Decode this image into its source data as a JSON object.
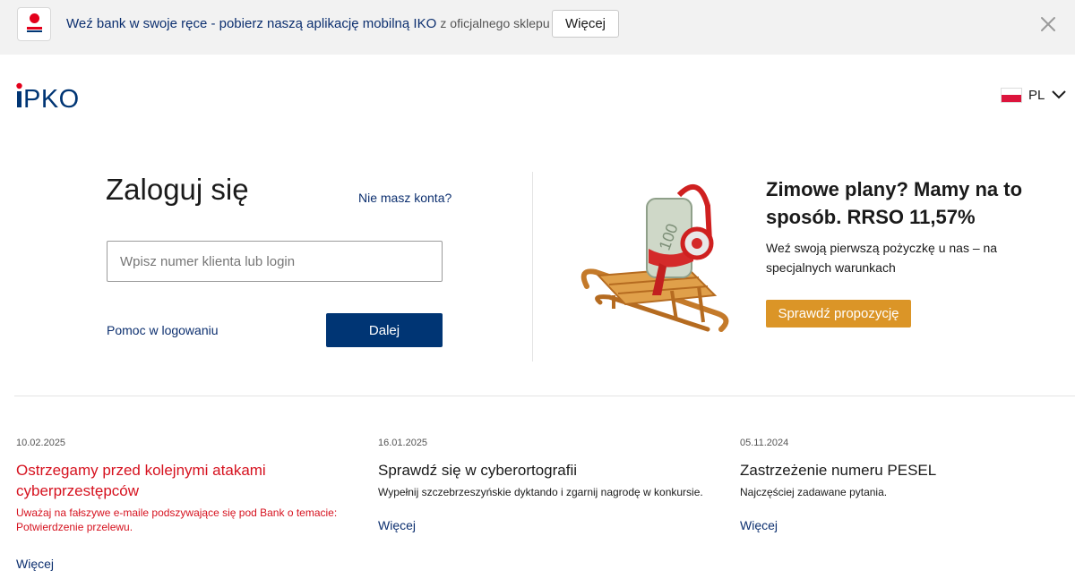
{
  "banner": {
    "icon": "iko-app-icon",
    "text_main": "Weź bank w swoje ręce - pobierz naszą aplikację mobilną IKO",
    "text_sub": "z oficjalnego sklepu",
    "more_label": "Więcej",
    "close_icon": "close-icon"
  },
  "header": {
    "logo": "iPKO",
    "lang": {
      "code": "PL",
      "flag": "poland-flag-icon",
      "chevron": "chevron-down-icon"
    }
  },
  "login": {
    "title": "Zaloguj się",
    "no_account": "Nie masz konta?",
    "input_placeholder": "Wpisz numer klienta lub login",
    "input_value": "",
    "help_label": "Pomoc w logowaniu",
    "next_label": "Dalej"
  },
  "promo": {
    "image": "sled-with-money-roll-illustration",
    "title": "Zimowe plany? Mamy na to sposób. RRSO 11,57%",
    "text": "Weź swoją pierwszą pożyczkę u nas – na specjalnych warunkach",
    "button_label": "Sprawdź propozycję"
  },
  "news": [
    {
      "date": "10.02.2025",
      "title": "Ostrzegamy przed kolejnymi atakami cyberprzestępców",
      "desc": "Uważaj na fałszywe e-maile podszywające się pod Bank o temacie: Potwierdzenie przelewu.",
      "more": "Więcej"
    },
    {
      "date": "16.01.2025",
      "title": "Sprawdź się w cyberortografii",
      "desc": "Wypełnij szczebrzeszyńskie dyktando i zgarnij nagrodę w konkursie.",
      "more": "Więcej"
    },
    {
      "date": "05.11.2024",
      "title": "Zastrzeżenie numeru PESEL",
      "desc": "Najczęściej zadawane pytania.",
      "more": "Więcej"
    }
  ],
  "colors": {
    "brand_navy": "#003574",
    "link_navy": "#0c2f6f",
    "brand_red": "#e3001b",
    "alert_red": "#d6121f",
    "promo_orange": "#db9527",
    "banner_bg": "#f2f2f2"
  }
}
